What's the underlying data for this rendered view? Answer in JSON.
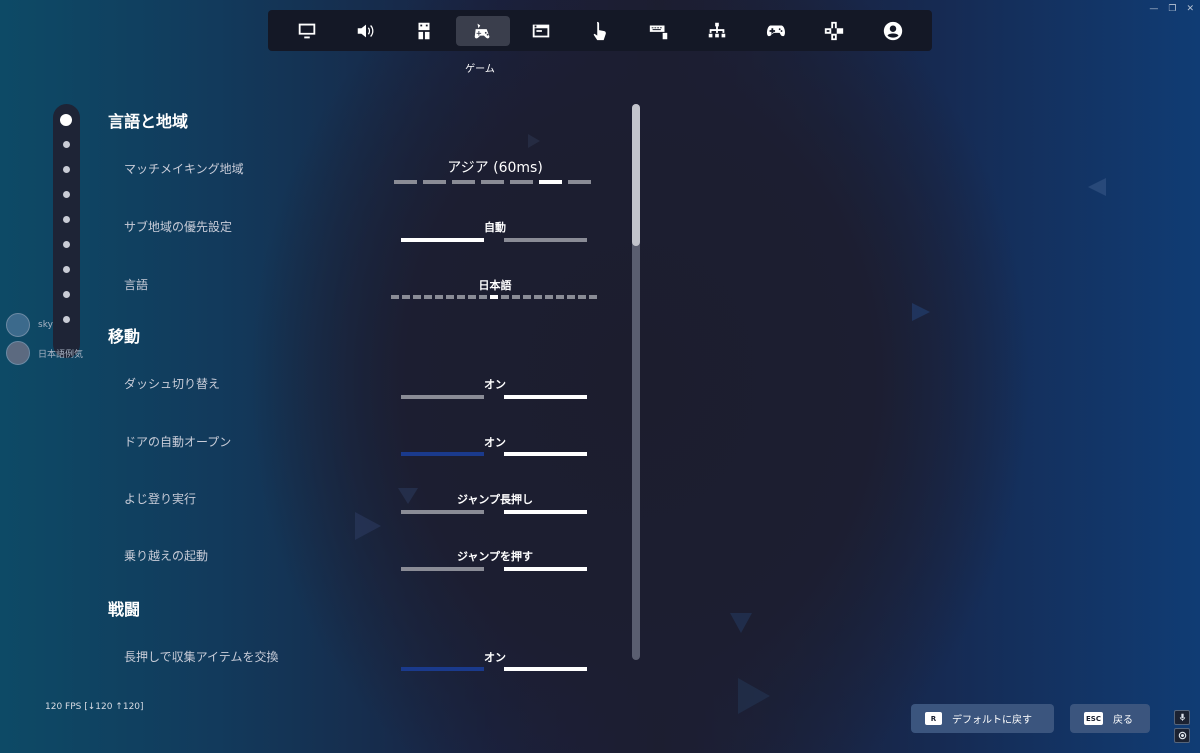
{
  "window": {
    "controls": [
      "—",
      "❐",
      "✕"
    ]
  },
  "topbar": {
    "tabs": [
      {
        "icon": "monitor-icon",
        "active": false
      },
      {
        "icon": "speaker-icon",
        "active": false
      },
      {
        "icon": "accessibility-icon",
        "active": false
      },
      {
        "icon": "game-icon",
        "active": true
      },
      {
        "icon": "window-icon",
        "active": false
      },
      {
        "icon": "touch-icon",
        "active": false
      },
      {
        "icon": "keyboard-mouse-icon",
        "active": false
      },
      {
        "icon": "hierarchy-icon",
        "active": false
      },
      {
        "icon": "gamepad-icon",
        "active": false
      },
      {
        "icon": "dpad-icon",
        "active": false
      },
      {
        "icon": "account-icon",
        "active": false
      }
    ],
    "active_caption": "ゲーム"
  },
  "social": [
    {
      "name": "sky"
    },
    {
      "name": "日本語例気"
    }
  ],
  "settings": {
    "section_region": "言語と地域",
    "matchmaking_label": "マッチメイキング地域",
    "matchmaking_value": "アジア (60ms)",
    "matchmaking_segments": 7,
    "matchmaking_selected": 6,
    "subregion_label": "サブ地域の優先設定",
    "subregion_value": "自動",
    "language_label": "言語",
    "language_value": "日本語",
    "language_segments": 19,
    "language_selected": 9,
    "section_movement": "移動",
    "sprint_label": "ダッシュ切り替え",
    "sprint_value": "オン",
    "door_label": "ドアの自動オープン",
    "door_value": "オン",
    "climb_label": "よじ登り実行",
    "climb_value": "ジャンプ長押し",
    "mantle_label": "乗り越えの起動",
    "mantle_value": "ジャンプを押す",
    "section_combat": "戦闘",
    "swap_label": "長押しで収集アイテムを交換",
    "swap_value": "オン"
  },
  "footer": {
    "fps": "120 FPS [↓120 ↑120]",
    "reset_key": "R",
    "reset_label": "デフォルトに戻す",
    "back_key": "ESC",
    "back_label": "戻る"
  },
  "colors": {
    "accent_blue": "#1a3a8c",
    "button_bg": "#3b557e",
    "active_white": "#ffffff",
    "inactive_gray": "#8a8c96"
  }
}
